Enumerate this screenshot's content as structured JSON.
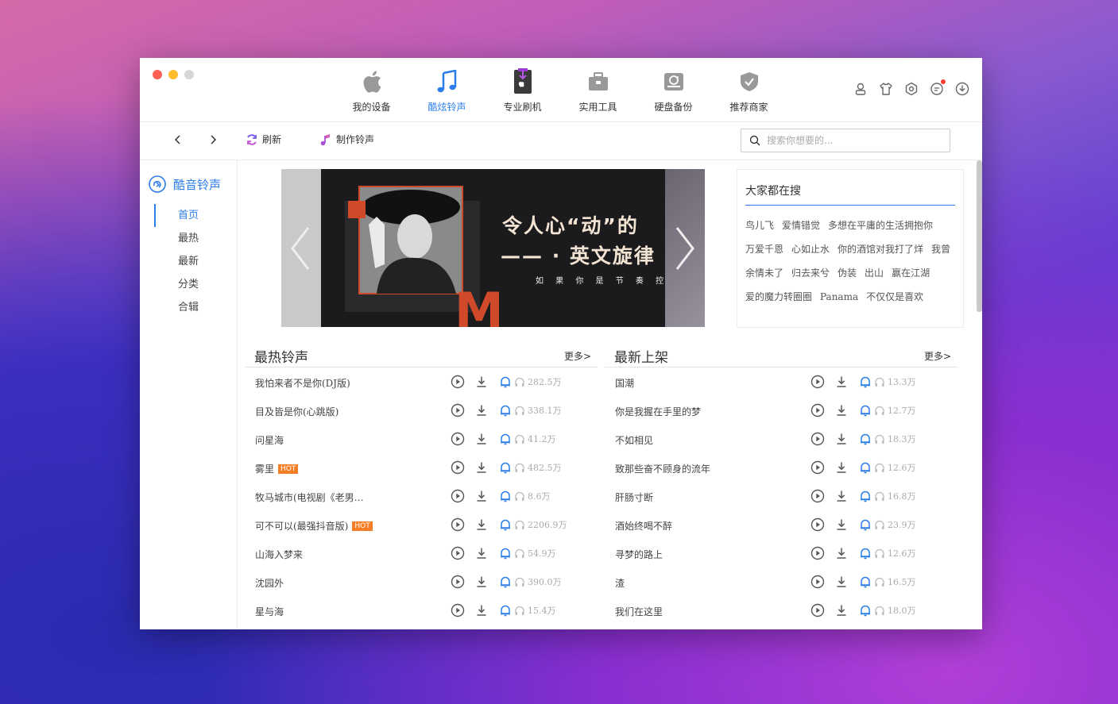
{
  "nav": {
    "tabs": [
      {
        "label": "我的设备",
        "icon": "apple-icon"
      },
      {
        "label": "酷炫铃声",
        "icon": "music-note-icon"
      },
      {
        "label": "专业刷机",
        "icon": "phone-flash-icon"
      },
      {
        "label": "实用工具",
        "icon": "toolbox-icon"
      },
      {
        "label": "硬盘备份",
        "icon": "disk-backup-icon"
      },
      {
        "label": "推荐商家",
        "icon": "shield-check-icon"
      }
    ],
    "active": 1
  },
  "toolbar": {
    "refresh": "刷新",
    "make_ringtone": "制作铃声",
    "search_placeholder": "搜索你想要的..."
  },
  "sidebar": {
    "title": "酷音铃声",
    "items": [
      "首页",
      "最热",
      "最新",
      "分类",
      "合辑"
    ],
    "active": 0
  },
  "banner": {
    "line1": "令人心“动”的",
    "line2": "—— · 英文旋律",
    "sub": "如 果 你 是 节 奏 控",
    "letter": "M"
  },
  "hot_search": {
    "title": "大家都在搜",
    "rows": [
      [
        "鸟儿飞",
        "爱情错觉",
        "多想在平庸的生活拥抱你"
      ],
      [
        "万爱千恩",
        "心如止水",
        "你的酒馆对我打了烊",
        "我曾"
      ],
      [
        "余情未了",
        "归去来兮",
        "伪装",
        "出山",
        "赢在江湖"
      ],
      [
        "爱的魔力转圈圈",
        "Panama",
        "不仅仅是喜欢"
      ]
    ]
  },
  "hottest": {
    "title": "最热铃声",
    "more": "更多>",
    "hot_label": "HOT",
    "songs": [
      {
        "name": "我怕来者不是你(DJ版)",
        "plays": "282.5万",
        "hot": false
      },
      {
        "name": "目及皆是你(心跳版)",
        "plays": "338.1万",
        "hot": false
      },
      {
        "name": "问星海",
        "plays": "41.2万",
        "hot": false
      },
      {
        "name": "雾里",
        "plays": "482.5万",
        "hot": true
      },
      {
        "name": "牧马城市(电视剧《老男…",
        "plays": "8.6万",
        "hot": false
      },
      {
        "name": "可不可以(最强抖音版)",
        "plays": "2206.9万",
        "hot": true
      },
      {
        "name": "山海入梦来",
        "plays": "54.9万",
        "hot": false
      },
      {
        "name": "沈园外",
        "plays": "390.0万",
        "hot": false
      },
      {
        "name": "星与海",
        "plays": "15.4万",
        "hot": false
      }
    ]
  },
  "newest": {
    "title": "最新上架",
    "more": "更多>",
    "songs": [
      {
        "name": "国潮",
        "plays": "13.3万"
      },
      {
        "name": "你是我握在手里的梦",
        "plays": "12.7万"
      },
      {
        "name": "不如相见",
        "plays": "18.3万"
      },
      {
        "name": "致那些奋不顾身的流年",
        "plays": "12.6万"
      },
      {
        "name": "肝肠寸断",
        "plays": "16.8万"
      },
      {
        "name": "酒始终喝不醉",
        "plays": "23.9万"
      },
      {
        "name": "寻梦的路上",
        "plays": "12.6万"
      },
      {
        "name": "渣",
        "plays": "16.5万"
      },
      {
        "name": "我们在这里",
        "plays": "18.0万"
      }
    ]
  },
  "colors": {
    "accent": "#2b7de9",
    "hot": "#f57e26",
    "banner_red": "#d04a2a"
  }
}
